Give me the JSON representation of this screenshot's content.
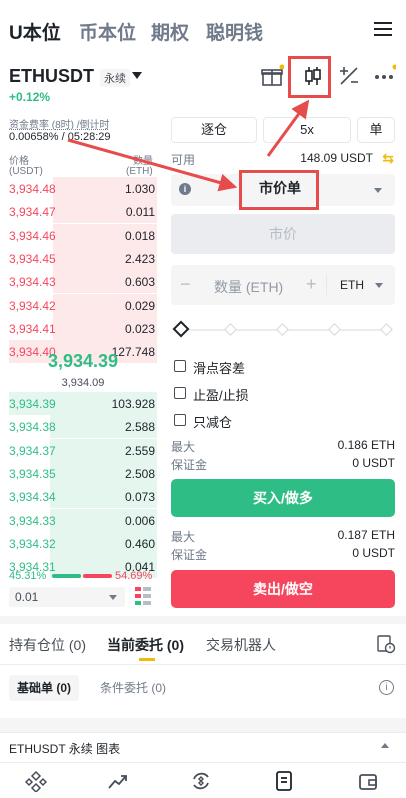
{
  "top_tabs": [
    "U本位",
    "币本位",
    "期权",
    "聪明钱"
  ],
  "pair": {
    "symbol": "ETHUSDT",
    "badge": "永续",
    "change": "+0.12%"
  },
  "funding": {
    "label": "资金费率 (8时) /倒计时",
    "value": "0.00658% / 05:28:29"
  },
  "orderbook": {
    "price_header": "价格",
    "price_unit": "(USDT)",
    "qty_header": "数量",
    "qty_unit": "(ETH)",
    "asks": [
      {
        "price": "3,934.48",
        "qty": "1.030",
        "depth": 0.7
      },
      {
        "price": "3,934.47",
        "qty": "0.011",
        "depth": 0.7
      },
      {
        "price": "3,934.46",
        "qty": "0.018",
        "depth": 0.7
      },
      {
        "price": "3,934.45",
        "qty": "2.423",
        "depth": 0.7
      },
      {
        "price": "3,934.43",
        "qty": "0.603",
        "depth": 0.7
      },
      {
        "price": "3,934.42",
        "qty": "0.029",
        "depth": 0.7
      },
      {
        "price": "3,934.41",
        "qty": "0.023",
        "depth": 0.7
      },
      {
        "price": "3,934.40",
        "qty": "127.748",
        "depth": 1.0
      }
    ],
    "last_price": "3,934.39",
    "mark_price": "3,934.09",
    "bids": [
      {
        "price": "3,934.39",
        "qty": "103.928",
        "depth": 1.0
      },
      {
        "price": "3,934.38",
        "qty": "2.588",
        "depth": 0.72
      },
      {
        "price": "3,934.37",
        "qty": "2.559",
        "depth": 0.72
      },
      {
        "price": "3,934.35",
        "qty": "2.508",
        "depth": 0.72
      },
      {
        "price": "3,934.34",
        "qty": "0.073",
        "depth": 0.72
      },
      {
        "price": "3,934.33",
        "qty": "0.006",
        "depth": 0.72
      },
      {
        "price": "3,934.32",
        "qty": "0.460",
        "depth": 0.72
      },
      {
        "price": "3,934.31",
        "qty": "0.041",
        "depth": 0.72
      }
    ],
    "buy_ratio": "45.31%",
    "sell_ratio": "54.69%",
    "precision": "0.01"
  },
  "order_form": {
    "margin_mode": "逐仓",
    "leverage": "5x",
    "position_mode": "单",
    "available_label": "可用",
    "available_value": "148.09 USDT",
    "order_type": "市价单",
    "price_placeholder": "市价",
    "qty_minus": "−",
    "qty_label": "数量 (ETH)",
    "qty_plus": "+",
    "qty_unit": "ETH",
    "checkboxes": [
      "滑点容差",
      "止盈/止损",
      "只减仓"
    ],
    "buy": {
      "max_label": "最大",
      "max_value": "0.186 ETH",
      "margin_label": "保证金",
      "margin_value": "0 USDT",
      "button": "买入/做多"
    },
    "sell": {
      "max_label": "最大",
      "max_value": "0.187 ETH",
      "margin_label": "保证金",
      "margin_value": "0 USDT",
      "button": "卖出/做空"
    }
  },
  "bottom_tabs": [
    "持有仓位 (0)",
    "当前委托 (0)",
    "交易机器人"
  ],
  "sub_tabs": [
    "基础单 (0)",
    "条件委托 (0)"
  ],
  "chart_bar_label": "ETHUSDT 永续  图表",
  "colors": {
    "green": "#2ebd85",
    "red": "#f6465d",
    "yellow": "#f0b90b",
    "annotation": "#e74c4c"
  }
}
